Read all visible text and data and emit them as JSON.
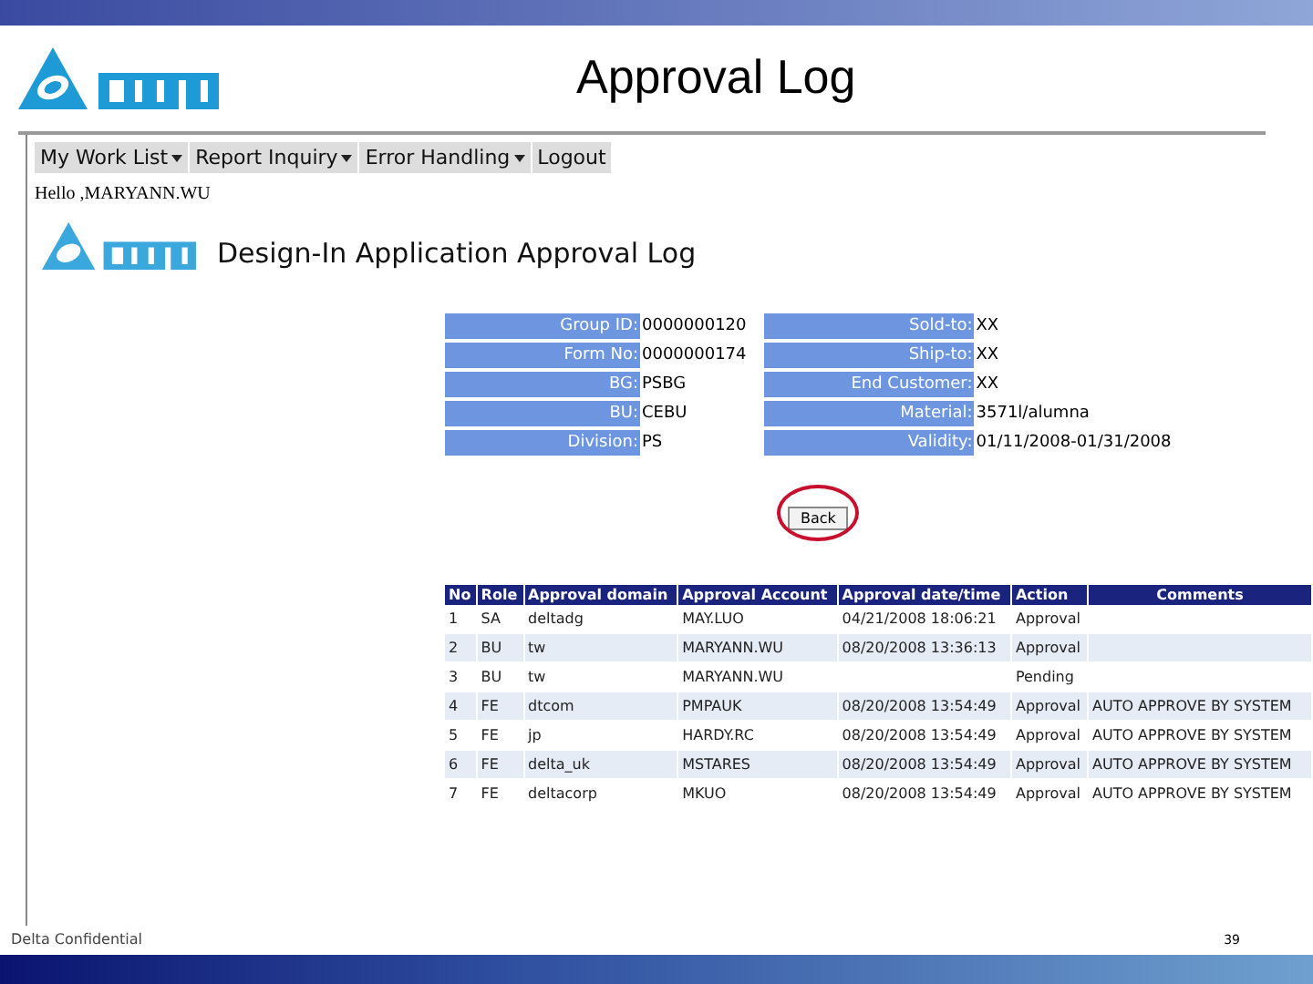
{
  "slide": {
    "title": "Approval Log",
    "footer": "Delta Confidential",
    "page_number": "39"
  },
  "menu": [
    {
      "label": "My Work List",
      "caret": true
    },
    {
      "label": "Report Inquiry",
      "caret": true
    },
    {
      "label": "Error Handling",
      "caret": true
    },
    {
      "label": "Logout",
      "caret": false
    }
  ],
  "greeting": "Hello ,MARYANN.WU",
  "page_title": "Design-In Application Approval Log",
  "info_left": [
    {
      "label": "Group ID:",
      "value": "0000000120"
    },
    {
      "label": "Form No:",
      "value": "0000000174"
    },
    {
      "label": "BG:",
      "value": "PSBG"
    },
    {
      "label": "BU:",
      "value": "CEBU"
    },
    {
      "label": "Division:",
      "value": "PS"
    }
  ],
  "info_right": [
    {
      "label": "Sold-to:",
      "value": "XX"
    },
    {
      "label": "Ship-to:",
      "value": "XX"
    },
    {
      "label": "End Customer:",
      "value": "XX"
    },
    {
      "label": "Material:",
      "value": "3571l/alumna"
    },
    {
      "label": "Validity:",
      "value": "01/11/2008-01/31/2008"
    }
  ],
  "back_button": "Back",
  "table": {
    "columns": [
      "No",
      "Role",
      "Approval domain",
      "Approval Account",
      "Approval date/time",
      "Action",
      "Comments"
    ],
    "rows": [
      [
        "1",
        "SA",
        "deltadg",
        "MAY.LUO",
        "04/21/2008 18:06:21",
        "Approval",
        ""
      ],
      [
        "2",
        "BU",
        "tw",
        "MARYANN.WU",
        "08/20/2008 13:36:13",
        "Approval",
        ""
      ],
      [
        "3",
        "BU",
        "tw",
        "MARYANN.WU",
        "",
        "Pending",
        ""
      ],
      [
        "4",
        "FE",
        "dtcom",
        "PMPAUK",
        "08/20/2008 13:54:49",
        "Approval",
        "AUTO APPROVE BY SYSTEM"
      ],
      [
        "5",
        "FE",
        "jp",
        "HARDY.RC",
        "08/20/2008 13:54:49",
        "Approval",
        "AUTO APPROVE BY SYSTEM"
      ],
      [
        "6",
        "FE",
        "delta_uk",
        "MSTARES",
        "08/20/2008 13:54:49",
        "Approval",
        "AUTO APPROVE BY SYSTEM"
      ],
      [
        "7",
        "FE",
        "deltacorp",
        "MKUO",
        "08/20/2008 13:54:49",
        "Approval",
        "AUTO APPROVE BY SYSTEM"
      ]
    ]
  }
}
